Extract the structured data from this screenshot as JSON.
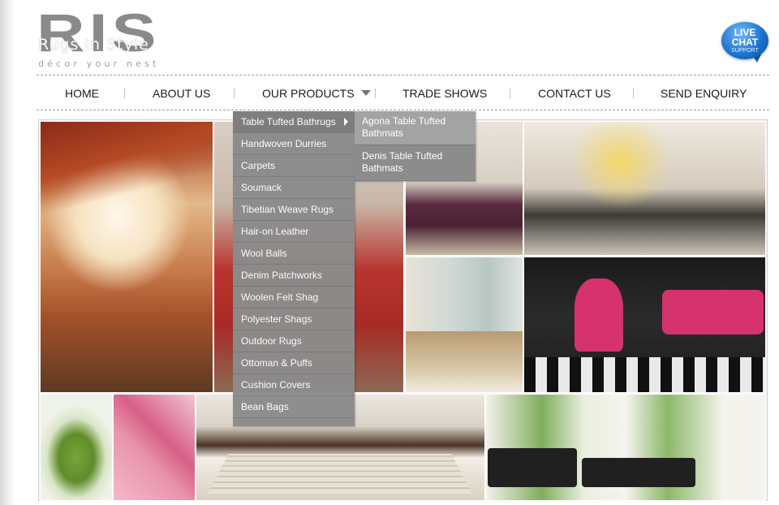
{
  "brand": {
    "logo_letters": "RIS",
    "name": "Rugs In Style",
    "tagline": "décor your nest"
  },
  "live_chat": {
    "line1": "LIVE",
    "line2": "CHAT",
    "line3": "SUPPORT",
    "color": "#1a6fc9"
  },
  "nav": {
    "items": [
      {
        "label": "HOME"
      },
      {
        "label": "ABOUT US"
      },
      {
        "label": "OUR PRODUCTS",
        "icon": "chevron-down-icon"
      },
      {
        "label": "TRADE SHOWS"
      },
      {
        "label": "CONTACT US"
      },
      {
        "label": "SEND ENQUIRY"
      }
    ]
  },
  "products_menu": {
    "items": [
      {
        "label": "Table Tufted Bathrugs",
        "has_submenu": true,
        "active": true
      },
      {
        "label": "Handwoven Durries"
      },
      {
        "label": "Carpets"
      },
      {
        "label": "Soumack"
      },
      {
        "label": "Tibetian Weave Rugs"
      },
      {
        "label": "Hair-on Leather"
      },
      {
        "label": "Wool Balls"
      },
      {
        "label": "Denim Patchworks"
      },
      {
        "label": "Woolen Felt Shag"
      },
      {
        "label": "Polyester Shags"
      },
      {
        "label": "Outdoor Rugs"
      },
      {
        "label": "Ottoman & Puffs"
      },
      {
        "label": "Cushion Covers"
      },
      {
        "label": "Bean Bags"
      }
    ],
    "submenu": [
      {
        "label": "Agona Table Tufted Bathmats",
        "active": true
      },
      {
        "label": "Denis Table Tufted Bathmats"
      }
    ]
  },
  "gallery": {
    "photos": [
      "living-room-red-curtains-photo",
      "red-bedding-photo",
      "purple-sofa-photo",
      "lounge-wicker-chairs-photo",
      "sunroom-armchairs-photo",
      "black-pink-chairs-photo",
      "green-bathmat-photo",
      "pink-bathmat-photo",
      "grey-area-rug-photo",
      "black-sofa-living-room-photo"
    ]
  },
  "colors": {
    "menu_bg": "#8c8c8c",
    "nav_text": "#1a1a1a",
    "logo": "#8a8a8a"
  }
}
